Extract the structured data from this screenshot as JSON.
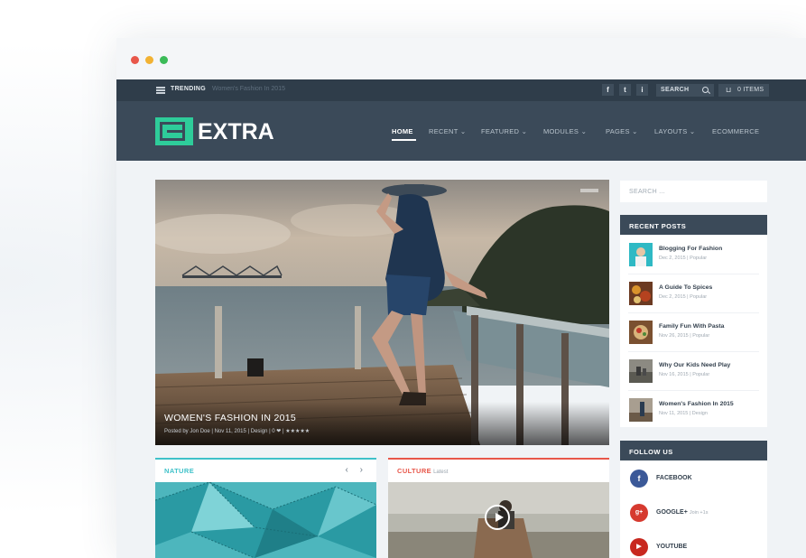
{
  "browser": {
    "dots": [
      "#e8574a",
      "#f2b233",
      "#3bbb58"
    ]
  },
  "topbar": {
    "trending_label": "TRENDING",
    "trending_text": "Women's Fashion In 2015",
    "social_icons": [
      "f",
      "t",
      "i"
    ],
    "search_label": "SEARCH",
    "cart_label": "0 ITEMS"
  },
  "header": {
    "logo_text": "EXTRA",
    "nav": [
      "HOME",
      "RECENT ⌄",
      "FEATURED ⌄",
      "MODULES ⌄",
      "PAGES ⌄",
      "LAYOUTS ⌄",
      "ECOMMERCE"
    ],
    "active_nav": "HOME"
  },
  "hero": {
    "title": "WOMEN'S FASHION IN 2015",
    "meta": "Posted by Jon Doe | Nov 11, 2015 | Design | 0 ❤ | ★★★★★"
  },
  "sidebar": {
    "search_placeholder": "SEARCH ...",
    "recent_title": "RECENT POSTS",
    "posts": [
      {
        "title": "Blogging For Fashion",
        "meta": "Dec 2, 2015 | Popular"
      },
      {
        "title": "A Guide To Spices",
        "meta": "Dec 2, 2015 | Popular"
      },
      {
        "title": "Family Fun With Pasta",
        "meta": "Nov 26, 2015 | Popular"
      },
      {
        "title": "Why Our Kids Need Play",
        "meta": "Nov 16, 2015 | Popular"
      },
      {
        "title": "Women's Fashion In 2015",
        "meta": "Nov 11, 2015 | Design"
      }
    ],
    "follow_title": "FOLLOW US",
    "social": [
      {
        "label": "FACEBOOK",
        "sub": "",
        "icon": "f",
        "color": "#3b5998"
      },
      {
        "label": "GOOGLE+",
        "sub": "Join +1s",
        "icon": "g+",
        "color": "#d63a2f"
      },
      {
        "label": "YOUTUBE",
        "sub": "",
        "icon": "▶",
        "color": "#c8281f"
      }
    ]
  },
  "cards": {
    "nature": {
      "label": "NATURE",
      "accent": "#3fc1c9",
      "arrows": "‹ ›"
    },
    "culture": {
      "label": "CULTURE",
      "sub": "Latest",
      "accent": "#e8574a"
    }
  }
}
